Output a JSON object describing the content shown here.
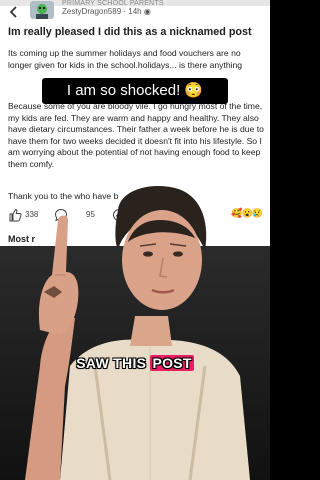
{
  "header": {
    "group_name": "PRIMARY SCHOOL PARENTS",
    "author": "ZestyDragon589",
    "time": "14h"
  },
  "post": {
    "title": "Im really pleased I did this as a nicknamed post",
    "para1": "Its coming up the summer holidays and food vouchers are no longer given for kids in the school.holidays... is there anything",
    "para2": "Because some of you are bloody vile. I go hungry most of the time, my kids are fed. They are warm and happy and healthy. They also have dietary circumstances. Their father a week before he is due to have them for two weeks decided it doesn't fit into his lifestyle. So I am worrying about the potential of not having enough food to keep them comfy.",
    "para3": "Thank you to the     who have b",
    "like_count": "338",
    "comment_count": "95",
    "reaction_emojis": "🥰😮😢",
    "most_label": "Most r"
  },
  "overlay": {
    "caption": "I am so shocked! 😳",
    "subtitle_main": "SAW THIS ",
    "subtitle_highlight": "POST"
  },
  "colors": {
    "banner_bg": "#000000",
    "subtitle_highlight": "#e91e63",
    "like_blue": "#1877f2"
  }
}
